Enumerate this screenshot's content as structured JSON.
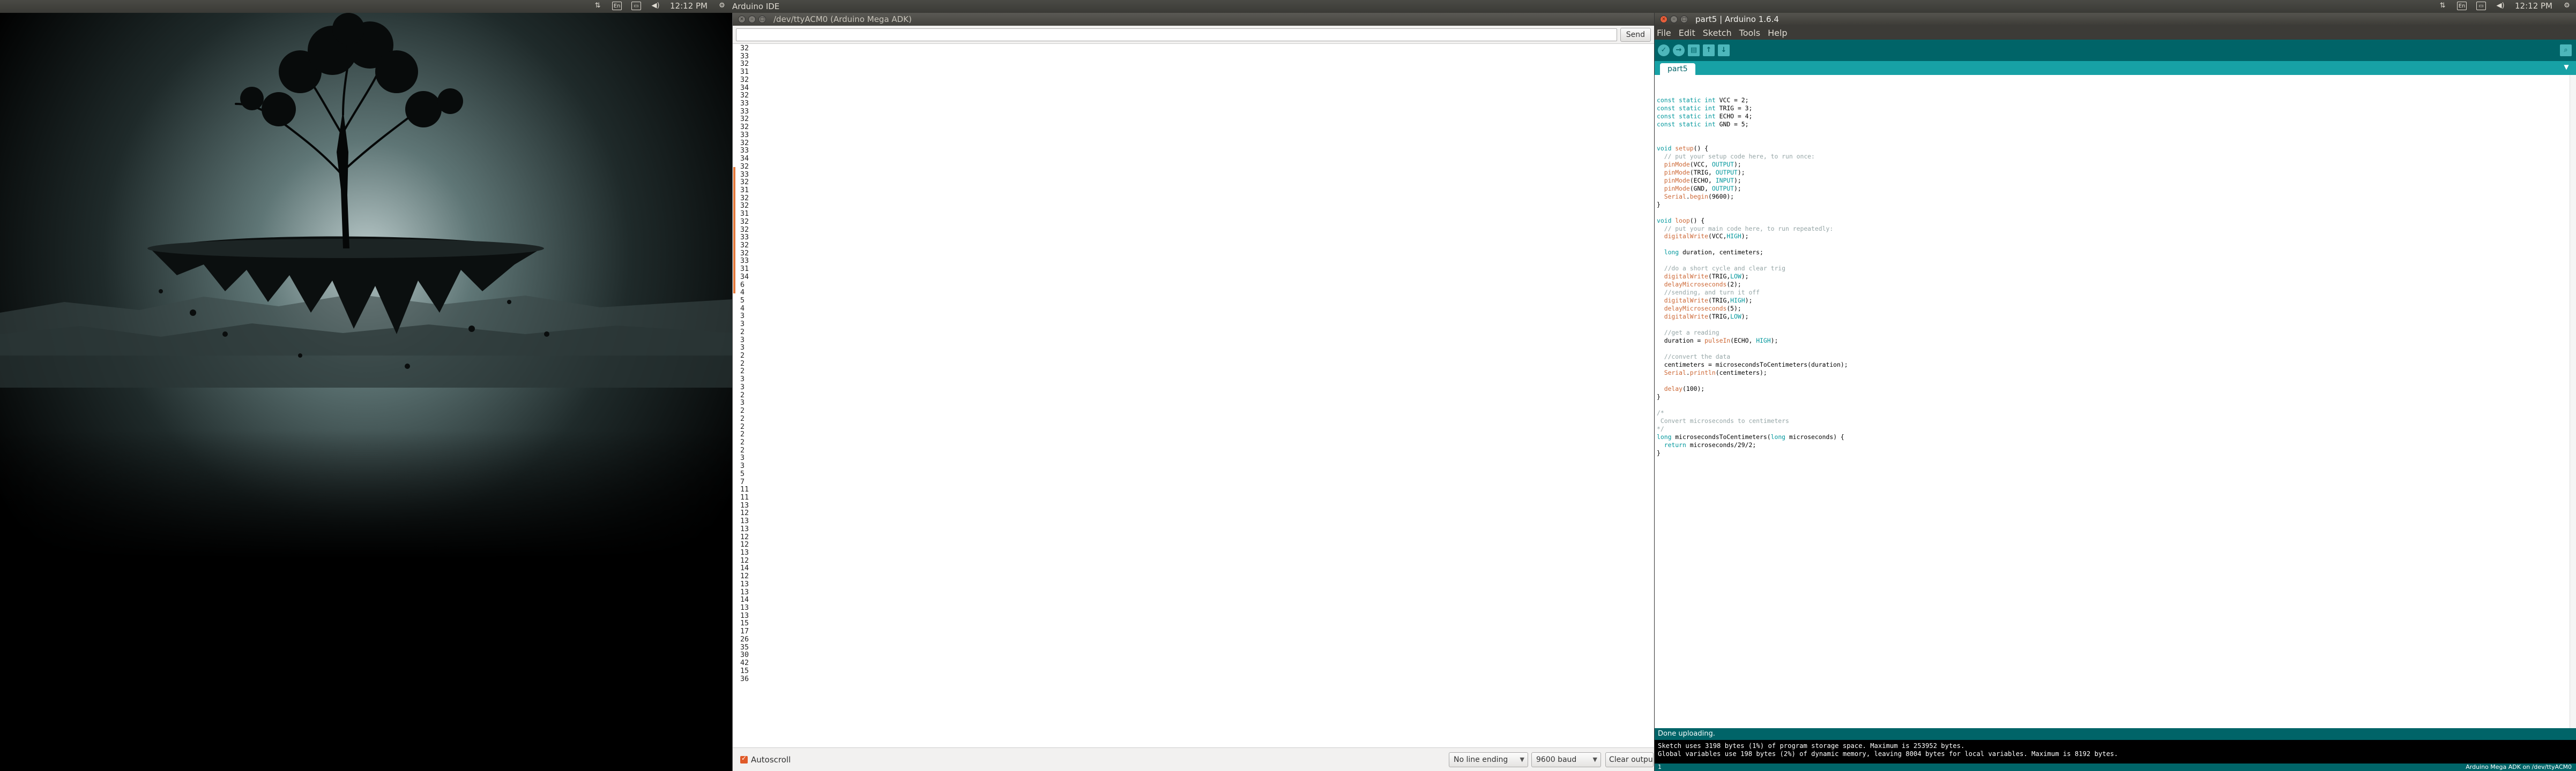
{
  "topbar": {
    "app_name": "Arduino IDE",
    "time": "12:12 PM",
    "right_time": "12:12 PM"
  },
  "serial_window": {
    "title": "/dev/ttyACM0 (Arduino Mega ADK)",
    "send_label": "Send",
    "output_lines": [
      "32",
      "33",
      "32",
      "31",
      "32",
      "34",
      "32",
      "33",
      "33",
      "32",
      "32",
      "33",
      "32",
      "33",
      "34",
      "32",
      "33",
      "32",
      "31",
      "32",
      "32",
      "31",
      "32",
      "32",
      "33",
      "32",
      "32",
      "33",
      "31",
      "34",
      "6",
      "4",
      "5",
      "4",
      "3",
      "3",
      "2",
      "3",
      "3",
      "2",
      "2",
      "2",
      "3",
      "3",
      "2",
      "3",
      "2",
      "2",
      "2",
      "2",
      "2",
      "2",
      "3",
      "3",
      "5",
      "7",
      "11",
      "11",
      "13",
      "12",
      "13",
      "13",
      "12",
      "12",
      "13",
      "12",
      "14",
      "12",
      "13",
      "13",
      "14",
      "13",
      "13",
      "15",
      "17",
      "26",
      "35",
      "30",
      "42",
      "15",
      "36"
    ],
    "autoscroll_label": "Autoscroll",
    "line_ending": "No line ending",
    "baud": "9600 baud",
    "clear_label": "Clear output"
  },
  "ide_window": {
    "title": "part5 | Arduino 1.6.4",
    "menus": [
      "File",
      "Edit",
      "Sketch",
      "Tools",
      "Help"
    ],
    "tab_label": "part5",
    "status_text": "Done uploading.",
    "console_lines": [
      "Sketch uses 3198 bytes (1%) of program storage space. Maximum is 253952 bytes.",
      "Global variables use 198 bytes (2%) of dynamic memory, leaving 8004 bytes for local variables. Maximum is 8192 bytes."
    ],
    "line_number": "1",
    "board_info": "Arduino Mega ADK on /dev/ttyACM0"
  },
  "icons": {
    "verify": "check-icon",
    "upload": "arrow-right-icon",
    "new": "new-file-icon",
    "open": "open-icon",
    "save": "save-icon",
    "serial_monitor": "magnifier-icon"
  },
  "colors": {
    "arduino_teal": "#006468",
    "arduino_light_teal": "#17a1a5",
    "ubuntu_panel": "#3c3b37",
    "close_orange": "#e9603c"
  }
}
